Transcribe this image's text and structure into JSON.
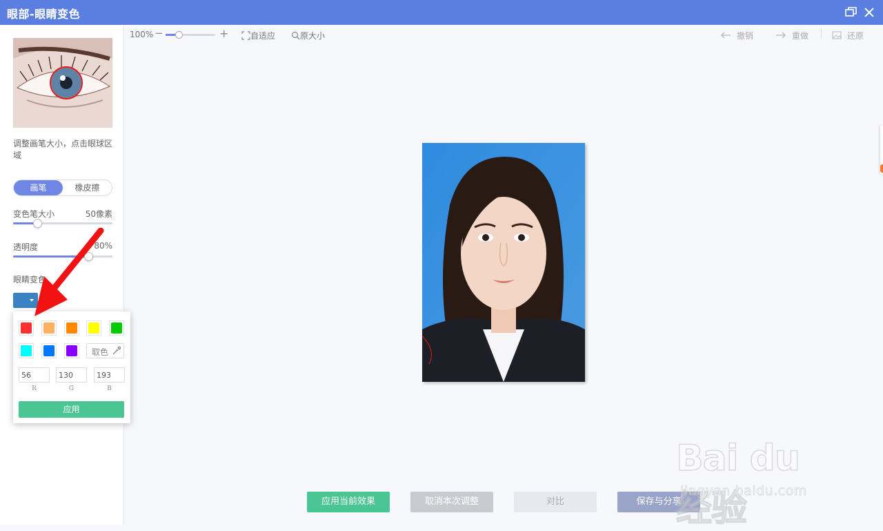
{
  "window": {
    "title": "眼部-眼睛变色"
  },
  "sidebar": {
    "hint": "调整画笔大小，点击眼球区域",
    "modes": {
      "brush": "画笔",
      "eraser": "橡皮擦",
      "active": "brush"
    },
    "brush_size": {
      "label": "变色笔大小",
      "value": "50像素",
      "fraction": 0.24
    },
    "opacity": {
      "label": "透明度",
      "value": "80%",
      "fraction": 0.76
    },
    "eye_color": {
      "label": "眼睛变色",
      "selected_color": "#3a82c1"
    }
  },
  "color_popup": {
    "swatches": [
      "#ff3030",
      "#ffb15e",
      "#ff8800",
      "#ffff00",
      "#00cc00",
      "#00ffff",
      "#0077ff",
      "#8800ff"
    ],
    "picker_label": "取色",
    "r": {
      "value": "56",
      "label": "R"
    },
    "g": {
      "value": "130",
      "label": "G"
    },
    "b": {
      "value": "193",
      "label": "B"
    },
    "apply_label": "应用"
  },
  "toolbar": {
    "zoom": "100%",
    "zoom_minus": "−",
    "zoom_plus": "+",
    "fit": "自适应",
    "original_size": "原大小",
    "undo": "撤销",
    "redo": "重做",
    "restore": "还原"
  },
  "bottom": {
    "apply_effect": "应用当前效果",
    "cancel_adjust": "取消本次调整",
    "compare": "对比",
    "save_share": "保存与分享"
  },
  "watermark": {
    "brand": "Bai du 经验",
    "url": "jingyan.baidu.com"
  }
}
